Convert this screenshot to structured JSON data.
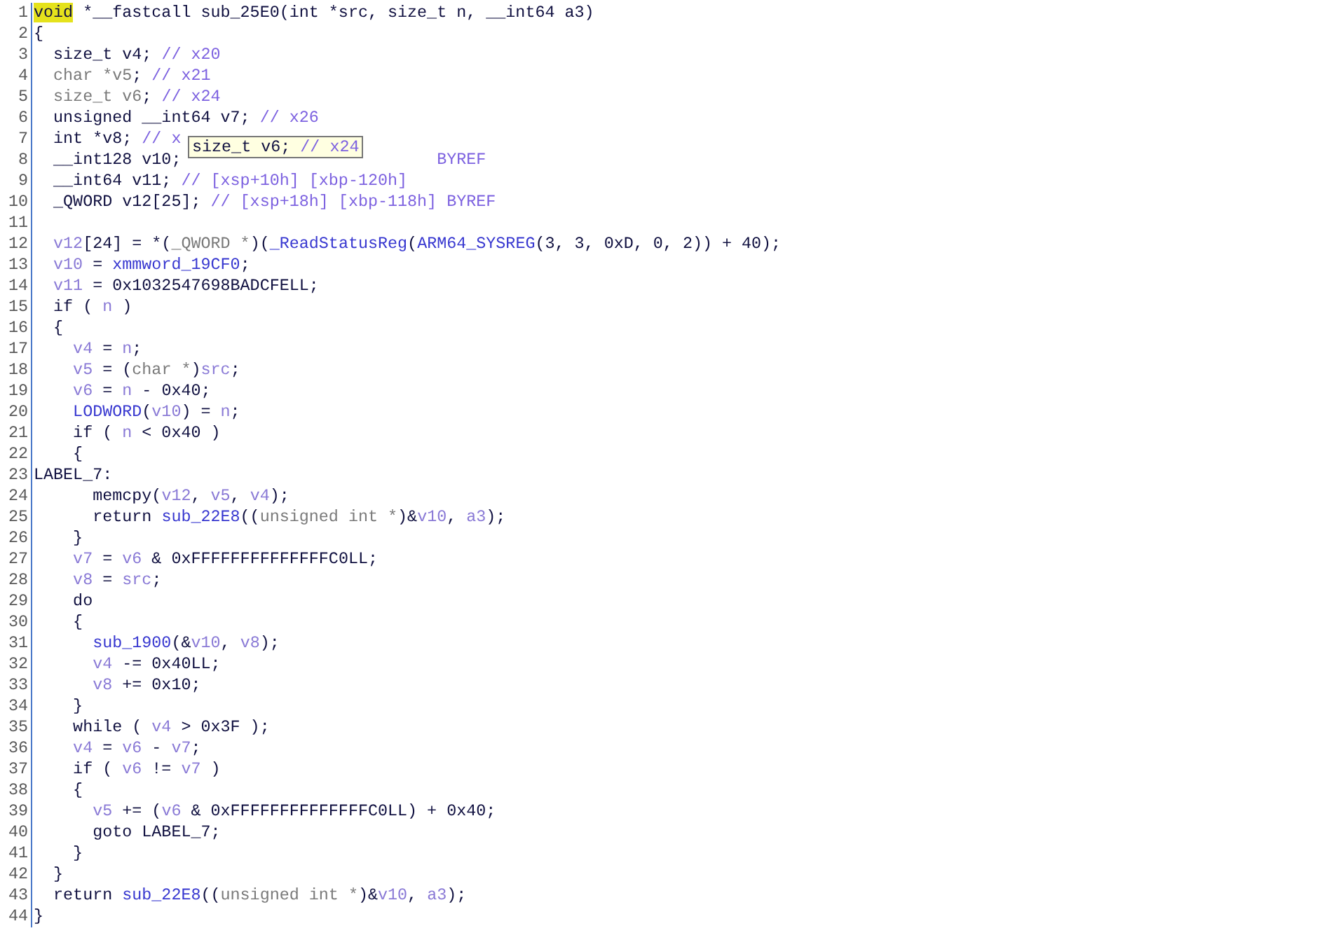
{
  "editor": {
    "lines": [
      {
        "number": "1",
        "segments": [
          {
            "kind": "mark",
            "text": "void"
          },
          {
            "kind": "plain",
            "text": " *__fastcall sub_25E0(int *src, size_t n, __int64 a3)"
          }
        ]
      },
      {
        "number": "2",
        "segments": [
          {
            "kind": "plain",
            "text": "{"
          }
        ]
      },
      {
        "number": "3",
        "segments": [
          {
            "kind": "plain",
            "text": "  size_t v4; "
          },
          {
            "kind": "comment",
            "text": "// x20"
          }
        ]
      },
      {
        "number": "4",
        "segments": [
          {
            "kind": "gray",
            "text": "  char *v5"
          },
          {
            "kind": "plain",
            "text": "; "
          },
          {
            "kind": "comment",
            "text": "// x21"
          }
        ]
      },
      {
        "number": "5",
        "segments": [
          {
            "kind": "gray",
            "text": "  size_t v6"
          },
          {
            "kind": "plain",
            "text": "; "
          },
          {
            "kind": "comment",
            "text": "// x24"
          }
        ]
      },
      {
        "number": "6",
        "segments": [
          {
            "kind": "plain",
            "text": "  unsigned __int64 v7; "
          },
          {
            "kind": "comment",
            "text": "// x26"
          }
        ]
      },
      {
        "number": "7",
        "segments": [
          {
            "kind": "plain",
            "text": "  int *v8; "
          },
          {
            "kind": "comment",
            "text": "// x"
          }
        ]
      },
      {
        "number": "8",
        "segments": [
          {
            "kind": "plain",
            "text": "  __int128 v10;"
          },
          {
            "kind": "comment",
            "text": "                          BYREF"
          }
        ]
      },
      {
        "number": "9",
        "segments": [
          {
            "kind": "plain",
            "text": "  __int64 v11; "
          },
          {
            "kind": "comment",
            "text": "// [xsp+10h] [xbp-120h]"
          }
        ]
      },
      {
        "number": "10",
        "segments": [
          {
            "kind": "plain",
            "text": "  _QWORD v12[25]; "
          },
          {
            "kind": "comment",
            "text": "// [xsp+18h] [xbp-118h] BYREF"
          }
        ]
      },
      {
        "number": "11"
      },
      {
        "number": "12",
        "segments": [
          {
            "kind": "var",
            "text": "  v12"
          },
          {
            "kind": "plain",
            "text": "[24] = *("
          },
          {
            "kind": "gray",
            "text": "_QWORD *"
          },
          {
            "kind": "plain",
            "text": ")("
          },
          {
            "kind": "func",
            "text": "_ReadStatusReg"
          },
          {
            "kind": "plain",
            "text": "("
          },
          {
            "kind": "func",
            "text": "ARM64_SYSREG"
          },
          {
            "kind": "plain",
            "text": "(3, 3, 0xD, 0, 2)) + 40);"
          }
        ]
      },
      {
        "number": "13",
        "segments": [
          {
            "kind": "var",
            "text": "  v10"
          },
          {
            "kind": "plain",
            "text": " = "
          },
          {
            "kind": "func",
            "text": "xmmword_19CF0"
          },
          {
            "kind": "plain",
            "text": ";"
          }
        ]
      },
      {
        "number": "14",
        "segments": [
          {
            "kind": "var",
            "text": "  v11"
          },
          {
            "kind": "plain",
            "text": " = 0x1032547698BADCFELL;"
          }
        ]
      },
      {
        "number": "15",
        "segments": [
          {
            "kind": "plain",
            "text": "  if ( "
          },
          {
            "kind": "var",
            "text": "n"
          },
          {
            "kind": "plain",
            "text": " )"
          }
        ]
      },
      {
        "number": "16",
        "segments": [
          {
            "kind": "plain",
            "text": "  {"
          }
        ]
      },
      {
        "number": "17",
        "segments": [
          {
            "kind": "var",
            "text": "    v4"
          },
          {
            "kind": "plain",
            "text": " = "
          },
          {
            "kind": "var",
            "text": "n"
          },
          {
            "kind": "plain",
            "text": ";"
          }
        ]
      },
      {
        "number": "18",
        "segments": [
          {
            "kind": "var",
            "text": "    v5"
          },
          {
            "kind": "plain",
            "text": " = ("
          },
          {
            "kind": "gray",
            "text": "char *"
          },
          {
            "kind": "plain",
            "text": ")"
          },
          {
            "kind": "var",
            "text": "src"
          },
          {
            "kind": "plain",
            "text": ";"
          }
        ]
      },
      {
        "number": "19",
        "segments": [
          {
            "kind": "var",
            "text": "    v6"
          },
          {
            "kind": "plain",
            "text": " = "
          },
          {
            "kind": "var",
            "text": "n"
          },
          {
            "kind": "plain",
            "text": " - 0x40;"
          }
        ]
      },
      {
        "number": "20",
        "segments": [
          {
            "kind": "func",
            "text": "    LODWORD"
          },
          {
            "kind": "plain",
            "text": "("
          },
          {
            "kind": "var",
            "text": "v10"
          },
          {
            "kind": "plain",
            "text": ") = "
          },
          {
            "kind": "var",
            "text": "n"
          },
          {
            "kind": "plain",
            "text": ";"
          }
        ]
      },
      {
        "number": "21",
        "segments": [
          {
            "kind": "plain",
            "text": "    if ( "
          },
          {
            "kind": "var",
            "text": "n"
          },
          {
            "kind": "plain",
            "text": " < 0x40 )"
          }
        ]
      },
      {
        "number": "22",
        "segments": [
          {
            "kind": "plain",
            "text": "    {"
          }
        ]
      },
      {
        "number": "23",
        "segments": [
          {
            "kind": "plain",
            "text": "LABEL_7:"
          }
        ]
      },
      {
        "number": "24",
        "segments": [
          {
            "kind": "plain",
            "text": "      memcpy("
          },
          {
            "kind": "var",
            "text": "v12"
          },
          {
            "kind": "plain",
            "text": ", "
          },
          {
            "kind": "var",
            "text": "v5"
          },
          {
            "kind": "plain",
            "text": ", "
          },
          {
            "kind": "var",
            "text": "v4"
          },
          {
            "kind": "plain",
            "text": ");"
          }
        ]
      },
      {
        "number": "25",
        "segments": [
          {
            "kind": "plain",
            "text": "      return "
          },
          {
            "kind": "func",
            "text": "sub_22E8"
          },
          {
            "kind": "plain",
            "text": "(("
          },
          {
            "kind": "gray",
            "text": "unsigned int *"
          },
          {
            "kind": "plain",
            "text": ")&"
          },
          {
            "kind": "var",
            "text": "v10"
          },
          {
            "kind": "plain",
            "text": ", "
          },
          {
            "kind": "var",
            "text": "a3"
          },
          {
            "kind": "plain",
            "text": ");"
          }
        ]
      },
      {
        "number": "26",
        "segments": [
          {
            "kind": "plain",
            "text": "    }"
          }
        ]
      },
      {
        "number": "27",
        "segments": [
          {
            "kind": "var",
            "text": "    v7"
          },
          {
            "kind": "plain",
            "text": " = "
          },
          {
            "kind": "var",
            "text": "v6"
          },
          {
            "kind": "plain",
            "text": " & 0xFFFFFFFFFFFFFFC0LL;"
          }
        ]
      },
      {
        "number": "28",
        "segments": [
          {
            "kind": "var",
            "text": "    v8"
          },
          {
            "kind": "plain",
            "text": " = "
          },
          {
            "kind": "var",
            "text": "src"
          },
          {
            "kind": "plain",
            "text": ";"
          }
        ]
      },
      {
        "number": "29",
        "segments": [
          {
            "kind": "plain",
            "text": "    do"
          }
        ]
      },
      {
        "number": "30",
        "segments": [
          {
            "kind": "plain",
            "text": "    {"
          }
        ]
      },
      {
        "number": "31",
        "segments": [
          {
            "kind": "func",
            "text": "      sub_1900"
          },
          {
            "kind": "plain",
            "text": "(&"
          },
          {
            "kind": "var",
            "text": "v10"
          },
          {
            "kind": "plain",
            "text": ", "
          },
          {
            "kind": "var",
            "text": "v8"
          },
          {
            "kind": "plain",
            "text": ");"
          }
        ]
      },
      {
        "number": "32",
        "segments": [
          {
            "kind": "var",
            "text": "      v4"
          },
          {
            "kind": "plain",
            "text": " -= 0x40LL;"
          }
        ]
      },
      {
        "number": "33",
        "segments": [
          {
            "kind": "var",
            "text": "      v8"
          },
          {
            "kind": "plain",
            "text": " += 0x10;"
          }
        ]
      },
      {
        "number": "34",
        "segments": [
          {
            "kind": "plain",
            "text": "    }"
          }
        ]
      },
      {
        "number": "35",
        "segments": [
          {
            "kind": "plain",
            "text": "    while ( "
          },
          {
            "kind": "var",
            "text": "v4"
          },
          {
            "kind": "plain",
            "text": " > 0x3F );"
          }
        ]
      },
      {
        "number": "36",
        "segments": [
          {
            "kind": "var",
            "text": "    v4"
          },
          {
            "kind": "plain",
            "text": " = "
          },
          {
            "kind": "var",
            "text": "v6"
          },
          {
            "kind": "plain",
            "text": " - "
          },
          {
            "kind": "var",
            "text": "v7"
          },
          {
            "kind": "plain",
            "text": ";"
          }
        ]
      },
      {
        "number": "37",
        "segments": [
          {
            "kind": "plain",
            "text": "    if ( "
          },
          {
            "kind": "var",
            "text": "v6"
          },
          {
            "kind": "plain",
            "text": " != "
          },
          {
            "kind": "var",
            "text": "v7"
          },
          {
            "kind": "plain",
            "text": " )"
          }
        ]
      },
      {
        "number": "38",
        "segments": [
          {
            "kind": "plain",
            "text": "    {"
          }
        ]
      },
      {
        "number": "39",
        "segments": [
          {
            "kind": "var",
            "text": "      v5"
          },
          {
            "kind": "plain",
            "text": " += ("
          },
          {
            "kind": "var",
            "text": "v6"
          },
          {
            "kind": "plain",
            "text": " & 0xFFFFFFFFFFFFFFC0LL) + 0x40;"
          }
        ]
      },
      {
        "number": "40",
        "segments": [
          {
            "kind": "plain",
            "text": "      goto LABEL_7;"
          }
        ]
      },
      {
        "number": "41",
        "segments": [
          {
            "kind": "plain",
            "text": "    }"
          }
        ]
      },
      {
        "number": "42",
        "segments": [
          {
            "kind": "plain",
            "text": "  }"
          }
        ]
      },
      {
        "number": "43",
        "segments": [
          {
            "kind": "plain",
            "text": "  return "
          },
          {
            "kind": "func",
            "text": "sub_22E8"
          },
          {
            "kind": "plain",
            "text": "(("
          },
          {
            "kind": "gray",
            "text": "unsigned int *"
          },
          {
            "kind": "plain",
            "text": ")&"
          },
          {
            "kind": "var",
            "text": "v10"
          },
          {
            "kind": "plain",
            "text": ", "
          },
          {
            "kind": "var",
            "text": "a3"
          },
          {
            "kind": "plain",
            "text": ");"
          }
        ]
      },
      {
        "number": "44",
        "segments": [
          {
            "kind": "plain",
            "text": "}"
          }
        ]
      }
    ],
    "tooltip": {
      "segments": [
        {
          "kind": "plain",
          "text": "size_t v6; "
        },
        {
          "kind": "comment",
          "text": "// x24"
        }
      ]
    }
  }
}
